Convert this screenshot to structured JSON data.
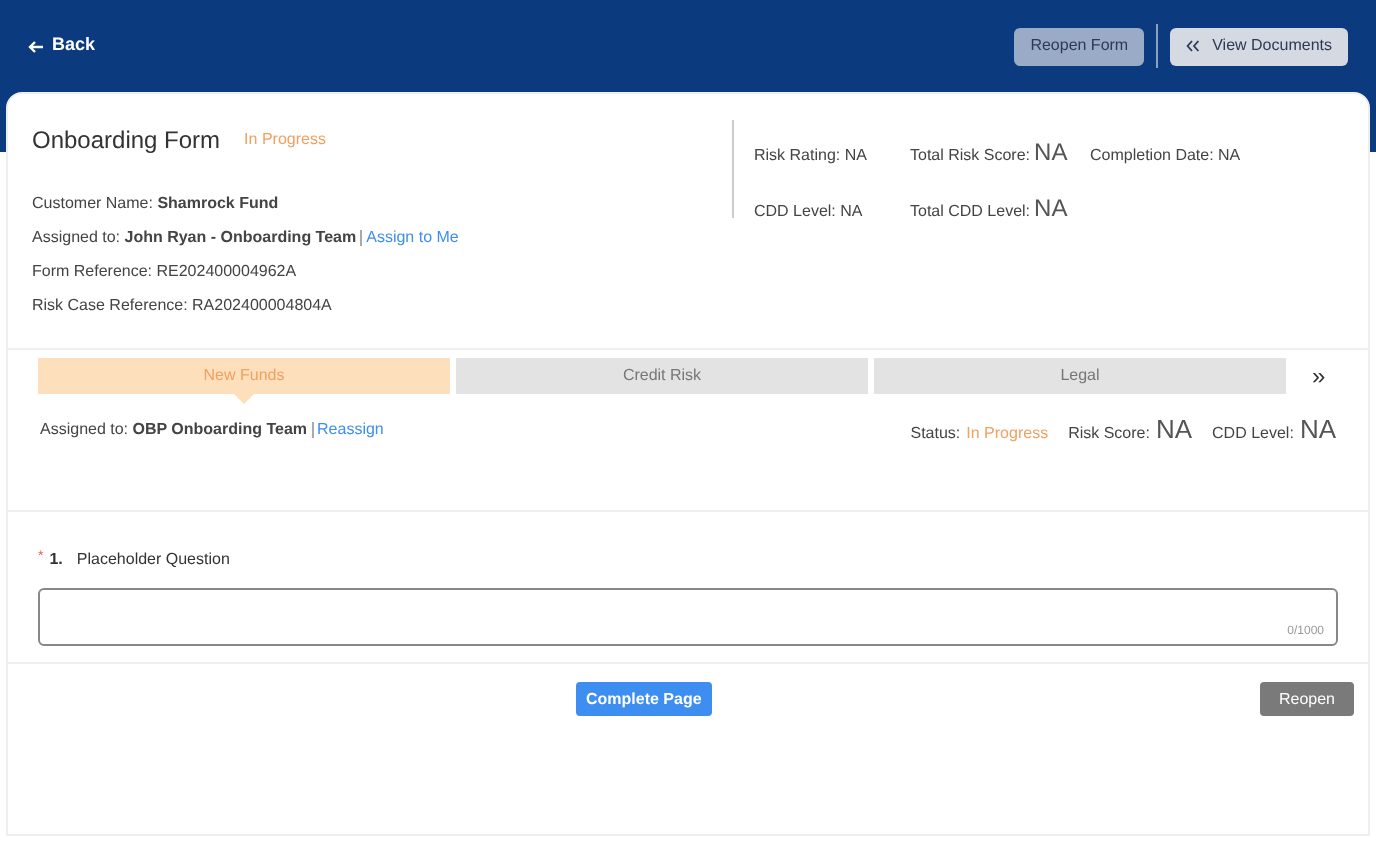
{
  "header": {
    "back": "Back",
    "buttons": [
      {
        "label": "Reopen Form",
        "kind": "plain"
      },
      {
        "label": "View Documents",
        "kind": "documents"
      }
    ]
  },
  "form": {
    "title": "Onboarding Form",
    "status": "In Progress",
    "details": [
      {
        "text": "Customer Name: **Shamrock Fund**"
      },
      {
        "text": "Assigned to: **John Ryan - Onboarding Team**",
        "link": "Assign to Me"
      },
      {
        "text": "Form Reference: RE202400004962A"
      },
      {
        "text": "Risk Case Reference: RA202400004804A"
      }
    ],
    "stats": [
      {
        "label": "Risk Rating: NA",
        "kind": "small"
      },
      {
        "label": "Total Risk Score:",
        "value": "NA",
        "kind": "big"
      },
      {
        "label": "Completion Date: NA",
        "kind": "small"
      },
      {
        "label": "CDD Level: NA",
        "kind": "small"
      },
      {
        "label": "Total CDD Level:",
        "value": "NA",
        "kind": "big"
      }
    ]
  },
  "stages": [
    {
      "label": "New Funds",
      "selected": true
    },
    {
      "label": "Credit Risk",
      "selected": false
    },
    {
      "label": "Legal",
      "selected": false
    }
  ],
  "stages_more": "»",
  "stage_info": {
    "assigned": "Assigned to: **OBP Onboarding Team**",
    "link": "Reassign",
    "status_label": "Status:",
    "status": "In Progress",
    "risk_label": "Risk Score:",
    "risk": "NA",
    "cdd_label": "CDD Level:",
    "cdd": "NA"
  },
  "question": {
    "required": "*",
    "number": "1.",
    "label": "Placeholder Question",
    "counter": "0/1000"
  },
  "footer": {
    "complete": "Complete Page",
    "reopen": "Reopen"
  }
}
